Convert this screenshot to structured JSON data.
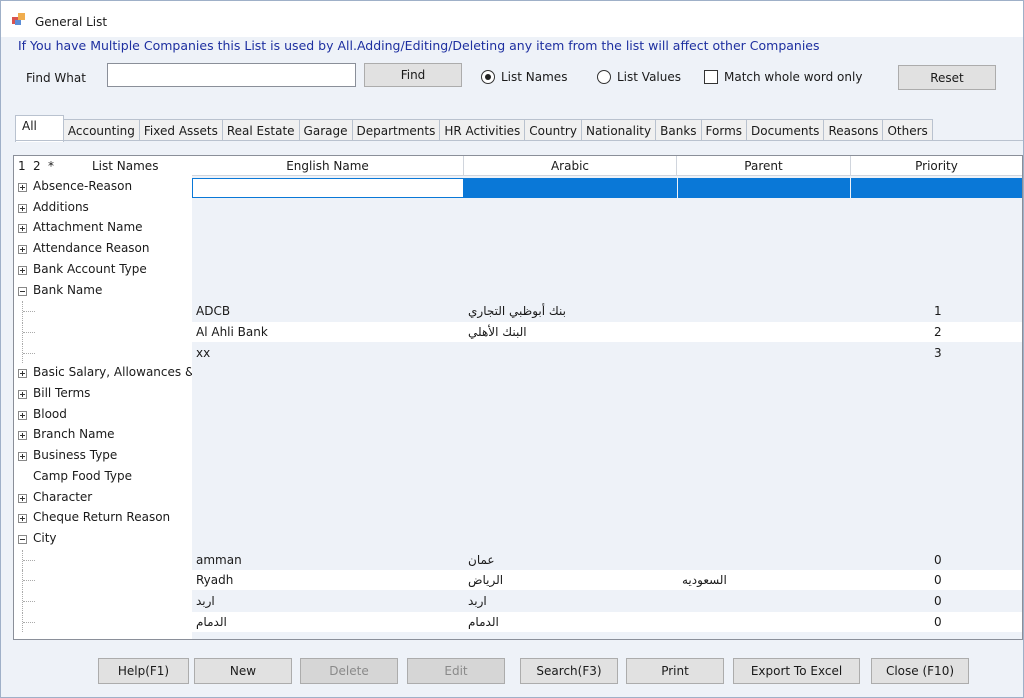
{
  "window": {
    "title": "General List",
    "app_icon": "app-icon"
  },
  "notice": "If You have Multiple Companies this List is used by All.Adding/Editing/Deleting any item from the list will affect other Companies",
  "search": {
    "label": "Find What",
    "value": "",
    "find_label": "Find",
    "radio_list_names": "List Names",
    "radio_list_values": "List Values",
    "selected_radio": "List Names",
    "match_whole_word": "Match whole word only",
    "match_checked": false,
    "reset_label": "Reset"
  },
  "tabs": [
    "All",
    "Accounting",
    "Fixed Assets",
    "Real Estate",
    "Garage",
    "Departments",
    "HR Activities",
    "Country",
    "Nationality",
    "Banks",
    "Forms",
    "Documents",
    "Reasons",
    "Others"
  ],
  "active_tab": "All",
  "grid": {
    "left_header": {
      "c1": "1",
      "c2": "2",
      "c3": "*",
      "title": "List Names"
    },
    "columns": [
      "English Name",
      "Arabic",
      "Parent",
      "Priority"
    ],
    "tree": [
      {
        "label": "Absence-Reason",
        "expander": "plus"
      },
      {
        "label": "Additions",
        "expander": "plus"
      },
      {
        "label": "Attachment Name",
        "expander": "plus"
      },
      {
        "label": "Attendance Reason",
        "expander": "plus"
      },
      {
        "label": "Bank Account Type",
        "expander": "plus"
      },
      {
        "label": "Bank Name",
        "expander": "minus"
      },
      {
        "label": "",
        "expander": "child"
      },
      {
        "label": "",
        "expander": "child"
      },
      {
        "label": "",
        "expander": "child"
      },
      {
        "label": "Basic Salary, Allowances &",
        "expander": "plus"
      },
      {
        "label": "Bill Terms",
        "expander": "plus"
      },
      {
        "label": "Blood",
        "expander": "plus"
      },
      {
        "label": "Branch Name",
        "expander": "plus"
      },
      {
        "label": "Business Type",
        "expander": "plus"
      },
      {
        "label": "Camp Food Type",
        "expander": "none"
      },
      {
        "label": "Character",
        "expander": "plus"
      },
      {
        "label": "Cheque Return Reason",
        "expander": "plus"
      },
      {
        "label": "City",
        "expander": "minus"
      },
      {
        "label": "",
        "expander": "child"
      },
      {
        "label": "",
        "expander": "child"
      },
      {
        "label": "",
        "expander": "child"
      },
      {
        "label": "",
        "expander": "child"
      }
    ],
    "bank_rows": [
      {
        "english": "ADCB",
        "arabic": "بنك أبوظبي التجاري",
        "parent": "",
        "priority": "1"
      },
      {
        "english": "Al Ahli Bank",
        "arabic": "البنك الأهلي",
        "parent": "",
        "priority": "2"
      },
      {
        "english": "xx",
        "arabic": "",
        "parent": "",
        "priority": "3"
      }
    ],
    "city_rows": [
      {
        "english": "amman",
        "arabic": "عمان",
        "parent": "",
        "priority": "0"
      },
      {
        "english": "Ryadh",
        "arabic": "الرياض",
        "parent": "السعوديه",
        "priority": "0"
      },
      {
        "english": "اربد",
        "arabic": "اربد",
        "parent": "",
        "priority": "0"
      },
      {
        "english": "الدمام",
        "arabic": "الدمام",
        "parent": "",
        "priority": "0"
      }
    ]
  },
  "buttons": {
    "help": "Help(F1)",
    "new": "New",
    "delete": "Delete",
    "edit": "Edit",
    "search": "Search(F3)",
    "print": "Print",
    "export": "Export To Excel",
    "close": "Close (F10)"
  },
  "colors": {
    "selection": "#0a78d7",
    "notice_text": "#1d2fa0"
  }
}
